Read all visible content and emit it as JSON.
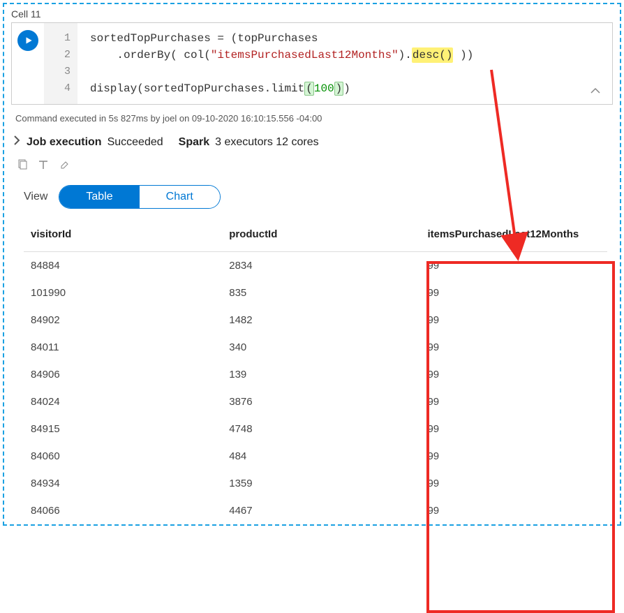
{
  "cell": {
    "label": "Cell 11",
    "line_numbers": [
      "1",
      "2",
      "3",
      "4"
    ],
    "code": {
      "l1": {
        "pre": "sortedTopPurchases = (topPurchases"
      },
      "l2": {
        "indent": "    .orderBy( col(",
        "str": "\"itemsPurchasedLast12Months\"",
        "mid": ").",
        "hl": "desc()",
        "end": " ))"
      },
      "l3": "",
      "l4": {
        "pre": "display(sortedTopPurchases.limit",
        "open": "(",
        "num": "100",
        "close": ")",
        "end": ")"
      }
    }
  },
  "status": {
    "exec_line": "Command executed in 5s 827ms by joel on 09-10-2020 16:10:15.556 -04:00",
    "job_label": "Job execution",
    "job_status": "Succeeded",
    "spark_label": "Spark",
    "spark_detail": "3 executors 12 cores"
  },
  "view": {
    "label": "View",
    "table": "Table",
    "chart": "Chart"
  },
  "table": {
    "headers": [
      "visitorId",
      "productId",
      "itemsPurchasedLast12Months"
    ],
    "rows": [
      [
        "84884",
        "2834",
        "99"
      ],
      [
        "101990",
        "835",
        "99"
      ],
      [
        "84902",
        "1482",
        "99"
      ],
      [
        "84011",
        "340",
        "99"
      ],
      [
        "84906",
        "139",
        "99"
      ],
      [
        "84024",
        "3876",
        "99"
      ],
      [
        "84915",
        "4748",
        "99"
      ],
      [
        "84060",
        "484",
        "99"
      ],
      [
        "84934",
        "1359",
        "99"
      ],
      [
        "84066",
        "4467",
        "99"
      ]
    ]
  },
  "chart_data": {
    "type": "table",
    "columns": [
      "visitorId",
      "productId",
      "itemsPurchasedLast12Months"
    ],
    "rows": [
      [
        84884,
        2834,
        99
      ],
      [
        101990,
        835,
        99
      ],
      [
        84902,
        1482,
        99
      ],
      [
        84011,
        340,
        99
      ],
      [
        84906,
        139,
        99
      ],
      [
        84024,
        3876,
        99
      ],
      [
        84915,
        4748,
        99
      ],
      [
        84060,
        484,
        99
      ],
      [
        84934,
        1359,
        99
      ],
      [
        84066,
        4467,
        99
      ]
    ]
  }
}
